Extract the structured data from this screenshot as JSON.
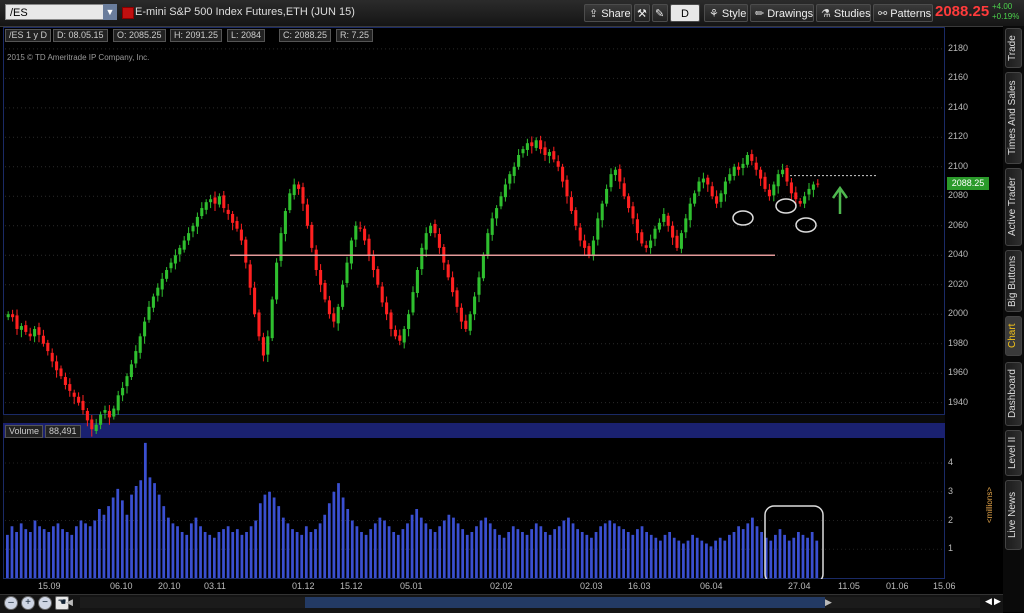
{
  "toolbar": {
    "symbol": "/ES",
    "symbol_dropdown": "▼",
    "instrument": "E-mini S&P 500 Index Futures,ETH (JUN 15)",
    "share_label": "Share",
    "timeframe_label": "D",
    "style_label": "Style",
    "drawings_label": "Drawings",
    "studies_label": "Studies",
    "patterns_label": "Patterns",
    "last_price": "2088.25",
    "change_abs": "+4.00",
    "change_pct": "+0.19%"
  },
  "chart_header": {
    "symbol_period": "/ES 1 y D",
    "date": "D: 08.05.15",
    "open": "O: 2085.25",
    "high": "H: 2091.25",
    "low": "L: 2084",
    "close": "C: 2088.25",
    "range": "R: 7.25",
    "copyright": "2015 © TD Ameritrade IP Company, Inc."
  },
  "volume_header": {
    "label": "Volume",
    "value": "88,491",
    "units": "<millions>"
  },
  "price_tag": "2088.25",
  "side_tabs": [
    {
      "label": "Trade",
      "active": false
    },
    {
      "label": "Times And Sales",
      "active": false
    },
    {
      "label": "Active Trader",
      "active": false
    },
    {
      "label": "Big Buttons",
      "active": false
    },
    {
      "label": "Chart",
      "active": true
    },
    {
      "label": "Dashboard",
      "active": false
    },
    {
      "label": "Level II",
      "active": false
    },
    {
      "label": "Live News",
      "active": false
    }
  ],
  "colors": {
    "up_candle": "#2fbf2f",
    "down_candle": "#ff2020",
    "volume": "#3a4fd0",
    "support_line": "#e39a9a",
    "arrow": "#4fb84f",
    "price_text": "#ff3b3b"
  },
  "chart_data": [
    {
      "type": "candlestick",
      "y_ticks": [
        "2180",
        "2160",
        "2140",
        "2120",
        "2100",
        "2080",
        "2060",
        "2040",
        "2020",
        "2000",
        "1980",
        "1960",
        "1940"
      ],
      "x_ticks": [
        "15.09",
        "06.10",
        "20.10",
        "03.11",
        "01.12",
        "15.12",
        "05.01",
        "02.02",
        "02.03",
        "16.03",
        "06.04",
        "27.04",
        "11.05",
        "01.06",
        "15.06"
      ],
      "ylim": [
        1933,
        2186
      ],
      "support_level": 2040,
      "resistance_level": 2094,
      "closes": [
        2000,
        1998,
        1990,
        1992,
        1988,
        1985,
        1990,
        1986,
        1980,
        1975,
        1968,
        1962,
        1958,
        1952,
        1948,
        1944,
        1940,
        1935,
        1928,
        1922,
        1925,
        1932,
        1935,
        1930,
        1936,
        1945,
        1950,
        1958,
        1966,
        1975,
        1985,
        1995,
        2005,
        2012,
        2018,
        2024,
        2030,
        2035,
        2040,
        2045,
        2050,
        2055,
        2060,
        2066,
        2072,
        2076,
        2078,
        2075,
        2080,
        2072,
        2068,
        2062,
        2058,
        2050,
        2035,
        2018,
        2000,
        1985,
        1972,
        1985,
        2010,
        2035,
        2055,
        2070,
        2082,
        2088,
        2085,
        2075,
        2060,
        2045,
        2030,
        2020,
        2010,
        2000,
        1995,
        2005,
        2020,
        2035,
        2050,
        2060,
        2058,
        2050,
        2040,
        2030,
        2020,
        2008,
        2000,
        1990,
        1985,
        1982,
        1990,
        2000,
        2015,
        2030,
        2045,
        2055,
        2060,
        2055,
        2045,
        2035,
        2025,
        2015,
        2005,
        1995,
        1990,
        2000,
        2012,
        2025,
        2040,
        2055,
        2065,
        2072,
        2080,
        2088,
        2095,
        2100,
        2108,
        2112,
        2116,
        2114,
        2118,
        2112,
        2108,
        2110,
        2105,
        2100,
        2090,
        2080,
        2070,
        2060,
        2050,
        2045,
        2040,
        2050,
        2065,
        2075,
        2085,
        2095,
        2098,
        2090,
        2080,
        2072,
        2065,
        2055,
        2048,
        2045,
        2050,
        2058,
        2062,
        2068,
        2060,
        2052,
        2045,
        2055,
        2065,
        2075,
        2082,
        2090,
        2092,
        2088,
        2080,
        2075,
        2082,
        2090,
        2095,
        2100,
        2098,
        2102,
        2108,
        2104,
        2098,
        2092,
        2085,
        2080,
        2088,
        2095,
        2098,
        2090,
        2082,
        2078,
        2075,
        2080,
        2085,
        2088,
        2088
      ]
    },
    {
      "type": "bar",
      "title": "Volume",
      "ylabel": "<millions>",
      "y_ticks": [
        "4",
        "3",
        "2",
        "1"
      ],
      "ylim": [
        0,
        4.8
      ],
      "values": [
        1.5,
        1.8,
        1.6,
        1.9,
        1.7,
        1.6,
        2.0,
        1.8,
        1.7,
        1.6,
        1.8,
        1.9,
        1.7,
        1.6,
        1.5,
        1.8,
        2.0,
        1.9,
        1.8,
        2.0,
        2.4,
        2.2,
        2.5,
        2.8,
        3.1,
        2.7,
        2.2,
        2.9,
        3.2,
        3.4,
        4.7,
        3.5,
        3.3,
        2.9,
        2.5,
        2.1,
        1.9,
        1.8,
        1.6,
        1.5,
        1.9,
        2.1,
        1.8,
        1.6,
        1.5,
        1.4,
        1.6,
        1.7,
        1.8,
        1.6,
        1.7,
        1.5,
        1.6,
        1.8,
        2.0,
        2.6,
        2.9,
        3.0,
        2.8,
        2.5,
        2.1,
        1.9,
        1.7,
        1.6,
        1.5,
        1.8,
        1.6,
        1.7,
        1.9,
        2.2,
        2.6,
        3.0,
        3.3,
        2.8,
        2.4,
        2.0,
        1.8,
        1.6,
        1.5,
        1.7,
        1.9,
        2.1,
        2.0,
        1.8,
        1.6,
        1.5,
        1.7,
        1.9,
        2.2,
        2.4,
        2.1,
        1.9,
        1.7,
        1.6,
        1.8,
        2.0,
        2.2,
        2.1,
        1.9,
        1.7,
        1.5,
        1.6,
        1.8,
        2.0,
        2.1,
        1.9,
        1.7,
        1.5,
        1.4,
        1.6,
        1.8,
        1.7,
        1.6,
        1.5,
        1.7,
        1.9,
        1.8,
        1.6,
        1.5,
        1.7,
        1.8,
        2.0,
        2.1,
        1.9,
        1.7,
        1.6,
        1.5,
        1.4,
        1.6,
        1.8,
        1.9,
        2.0,
        1.9,
        1.8,
        1.7,
        1.6,
        1.5,
        1.7,
        1.8,
        1.6,
        1.5,
        1.4,
        1.3,
        1.5,
        1.6,
        1.4,
        1.3,
        1.2,
        1.3,
        1.5,
        1.4,
        1.3,
        1.2,
        1.1,
        1.3,
        1.4,
        1.3,
        1.5,
        1.6,
        1.8,
        1.7,
        1.9,
        2.1,
        1.8,
        1.6,
        1.4,
        1.3,
        1.5,
        1.7,
        1.5,
        1.3,
        1.4,
        1.6,
        1.5,
        1.4,
        1.6,
        1.3
      ]
    }
  ]
}
